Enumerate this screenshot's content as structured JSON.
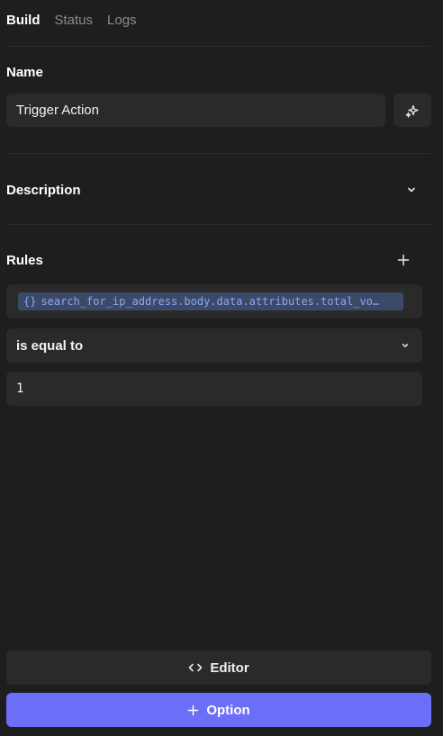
{
  "tabs": [
    {
      "label": "Build",
      "active": true
    },
    {
      "label": "Status",
      "active": false
    },
    {
      "label": "Logs",
      "active": false
    }
  ],
  "name": {
    "label": "Name",
    "value": "Trigger Action",
    "magic_icon": "sparkles-icon"
  },
  "description": {
    "label": "Description",
    "toggle_icon": "chevron-down-icon"
  },
  "rules": {
    "label": "Rules",
    "add_icon": "plus-icon",
    "variable_icon_text": "{}",
    "variable": "search_for_ip_address.body.data.attributes.total_vo…",
    "operator": "is equal to",
    "value": "1"
  },
  "footer": {
    "editor_label": "Editor",
    "editor_icon": "code-icon",
    "option_label": "Option",
    "option_icon": "plus-icon"
  },
  "colors": {
    "background": "#1e1e1e",
    "field": "#2a2a2a",
    "accent": "#6b6ef7",
    "token_bg": "#3b4a66",
    "token_text": "#8ea4ff"
  }
}
